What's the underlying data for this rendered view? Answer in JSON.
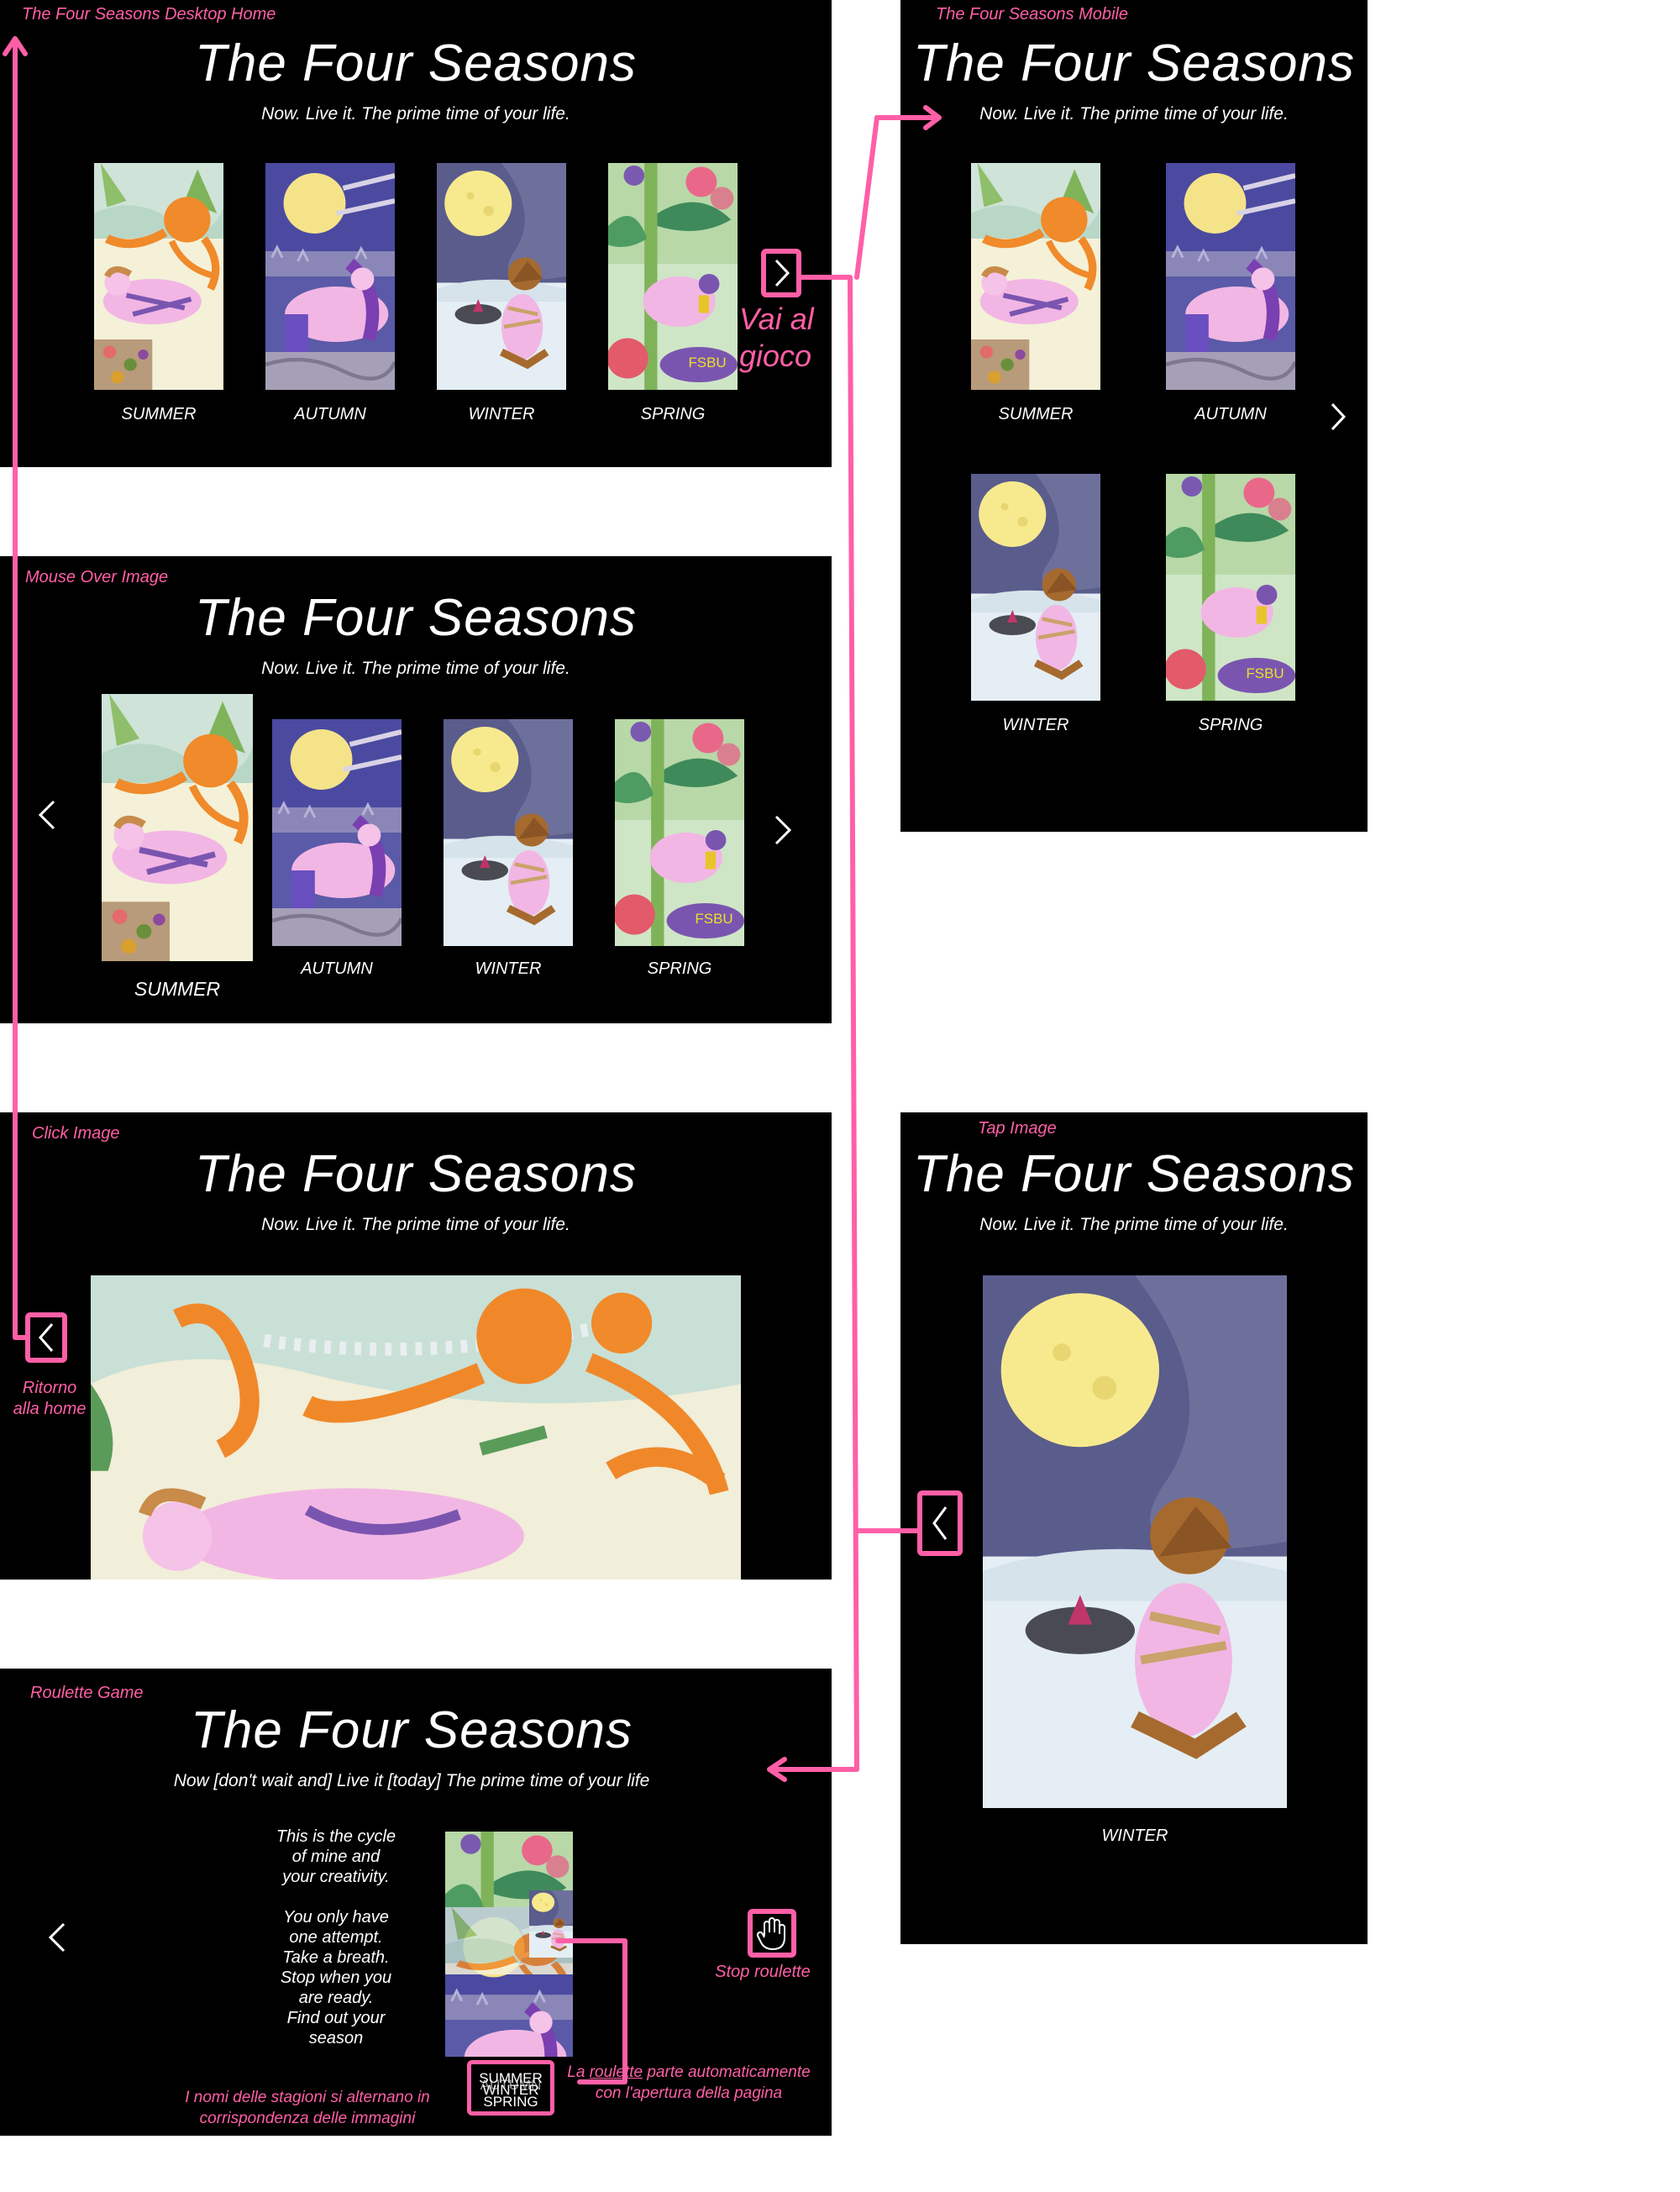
{
  "accent": "#ff5fa6",
  "panels": {
    "desktop": {
      "label": "The Four Seasons Desktop Home",
      "title": "The Four Seasons",
      "subtitle": "Now. Live it. The prime time of your life.",
      "seasons": [
        "SUMMER",
        "AUTUMN",
        "WINTER",
        "SPRING"
      ],
      "next_note": "Vai al gioco"
    },
    "mouseover": {
      "label": "Mouse Over Image",
      "title": "The Four Seasons",
      "subtitle": "Now. Live it. The prime time of your life.",
      "seasons": [
        "SUMMER",
        "AUTUMN",
        "WINTER",
        "SPRING"
      ]
    },
    "click": {
      "label": "Click Image",
      "title": "The Four Seasons",
      "subtitle": "Now. Live it. The prime time of your life.",
      "back_note": "Ritorno alla home"
    },
    "roulette": {
      "label": "Roulette Game",
      "title": "The Four Seasons",
      "subtitle": "Now [don't wait and] Live it [today] The prime time of your life",
      "intro_lines": [
        "This is the cycle",
        "of mine and",
        "your creativity.",
        "",
        "You only have",
        "one attempt.",
        "Take a breath.",
        "Stop when you",
        "are ready.",
        "Find out your",
        "season"
      ],
      "stop_label": "Stop roulette",
      "names_cycle": [
        "SUMMER",
        "AUTUMN",
        "WINTER",
        "SPRING"
      ],
      "note_names": "I nomi delle stagioni si alternano in corrispondenza delle immagini",
      "note_auto_prefix": "La ",
      "note_auto_link": "roulette",
      "note_auto_rest": " parte automaticamente con l'apertura della pagina"
    },
    "mobile": {
      "label": "The Four Seasons Mobile",
      "title": "The Four Seasons",
      "subtitle": "Now. Live it. The prime time of your life.",
      "seasons": [
        "SUMMER",
        "AUTUMN",
        "WINTER",
        "SPRING"
      ]
    },
    "tap": {
      "label": "Tap Image",
      "title": "The Four Seasons",
      "subtitle": "Now. Live it. The prime time of your life.",
      "season": "WINTER"
    }
  },
  "icons": {
    "next": "chevron-right-icon",
    "prev": "chevron-left-icon",
    "stop": "hand-icon"
  }
}
